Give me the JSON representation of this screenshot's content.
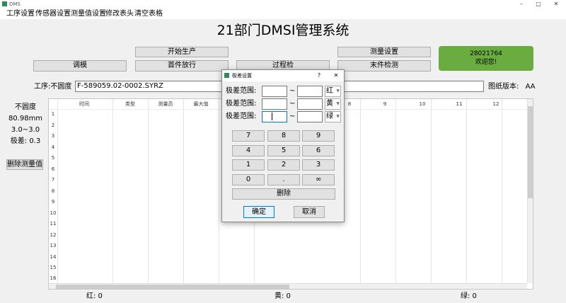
{
  "window": {
    "title": "DMS",
    "controls": [
      "–",
      "▢",
      "✕"
    ]
  },
  "menu": [
    "工序设置",
    "传感器设置",
    "测量值设置",
    "修改表头",
    "清空表格"
  ],
  "app_title": "21部门DMSI管理系统",
  "buttons": {
    "start_production": "开始生产",
    "adjust_mold": "调模",
    "first_piece": "首件放行",
    "process_check": "过程检",
    "measure_settings": "测量设置",
    "last_piece": "末件检测",
    "delete_value": "删除测量值"
  },
  "user": {
    "id": "28021764",
    "greeting": "欢迎您!"
  },
  "process": {
    "label": "工序:不圆度",
    "value": "F-589059.02-0002.SYRZ"
  },
  "drawing": {
    "label": "图纸版本:",
    "value": "AA"
  },
  "left_info": [
    "不圆度",
    "80.98mm",
    "3.0~3.0",
    "极差:  0.3"
  ],
  "table": {
    "headers": [
      "时间",
      "类型",
      "测量员",
      "最大值",
      "",
      "",
      "",
      "8",
      "9",
      "10",
      "11",
      "12"
    ],
    "rows": [
      "1",
      "2",
      "3",
      "4",
      "5",
      "6",
      "7",
      "8",
      "9",
      "10",
      "11",
      "12",
      "13",
      "14",
      "15",
      "16"
    ]
  },
  "status": {
    "red": "红:  0",
    "yellow": "黄:  0",
    "green": "绿:  0"
  },
  "dialog": {
    "title": "极差设置",
    "help": "?",
    "close": "✕",
    "range_label": "极差范围:",
    "tilde": "~",
    "colors": [
      "红",
      "黄",
      "绿"
    ],
    "keys": [
      "7",
      "8",
      "9",
      "4",
      "5",
      "6",
      "1",
      "2",
      "3",
      "0",
      ".",
      "∞"
    ],
    "delete": "删除",
    "ok": "确定",
    "cancel": "取消"
  }
}
